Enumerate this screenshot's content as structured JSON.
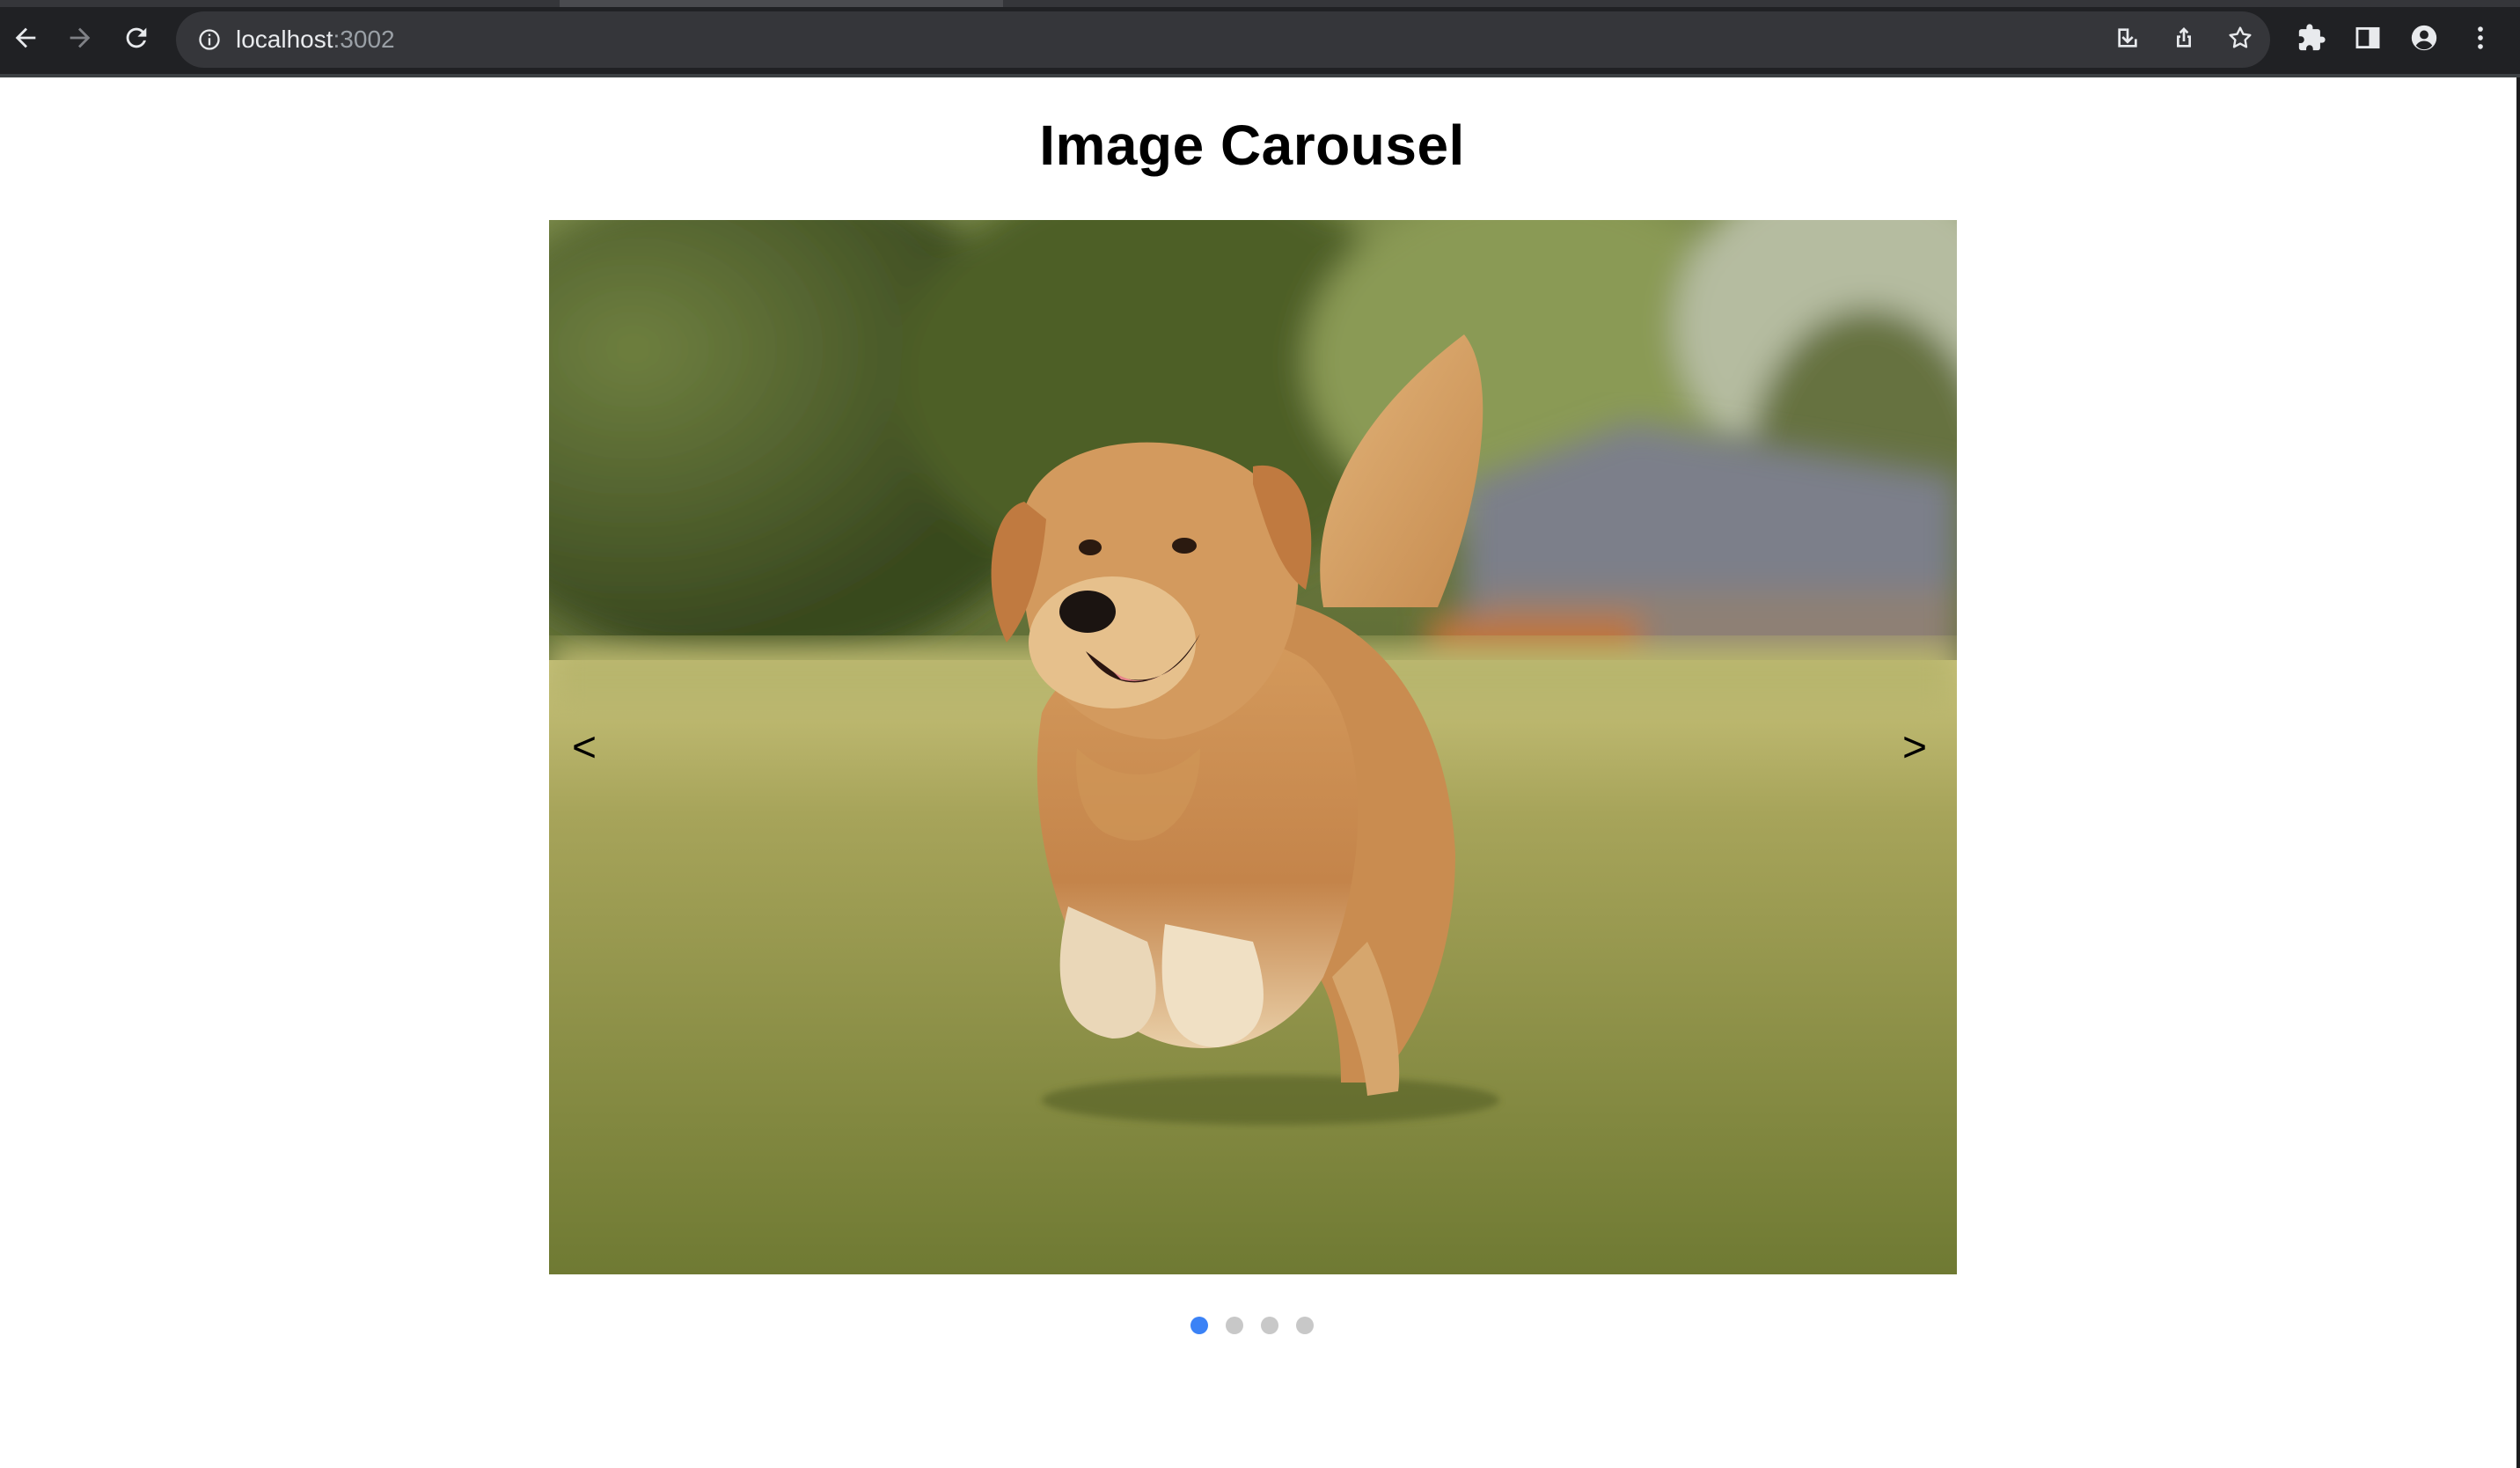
{
  "browser": {
    "url_host": "localhost",
    "url_port": ":3002",
    "icons": {
      "back": "arrow-left-icon",
      "forward": "arrow-right-icon",
      "reload": "reload-icon",
      "site_info": "info-icon",
      "install": "install-icon",
      "share": "share-icon",
      "bookmark": "star-icon",
      "extensions": "puzzle-icon",
      "side_panel": "side-panel-icon",
      "profile": "profile-icon",
      "menu": "kebab-menu-icon"
    },
    "colors": {
      "frame": "#202124",
      "omnibox": "#35363a",
      "icon": "#e8eaed",
      "icon_disabled": "#7f8186"
    }
  },
  "page": {
    "title": "Image Carousel",
    "carousel": {
      "prev_label": "<",
      "next_label": ">",
      "current_index": 1,
      "slide_count": 4,
      "current_slide_subject": "golden-retriever-running-on-grass"
    },
    "colors": {
      "dot_active": "#3b82f6",
      "dot_inactive": "#c8c8c8"
    }
  }
}
